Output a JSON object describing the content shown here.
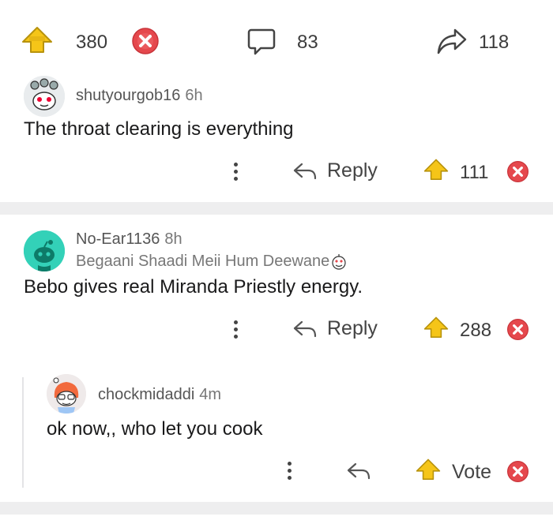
{
  "post_bar": {
    "upvotes": "380",
    "comments": "83",
    "shares": "118"
  },
  "comments": [
    {
      "username": "shutyourgob16",
      "time": "6h",
      "body": "The throat clearing is everything",
      "reply_label": "Reply",
      "votes": "111"
    },
    {
      "username": "No-Ear1136",
      "time": "8h",
      "flair": "Begaani Shaadi Meii Hum Deewane",
      "body": "Bebo gives real Miranda Priestly energy.",
      "reply_label": "Reply",
      "votes": "288"
    },
    {
      "username": "chockmidaddi",
      "time": "4m",
      "body": "ok now,, who let you cook",
      "vote_label": "Vote"
    }
  ],
  "colors": {
    "upvote": "#f5c518",
    "downvote": "#e5484d",
    "divider": "#eeeeef"
  }
}
